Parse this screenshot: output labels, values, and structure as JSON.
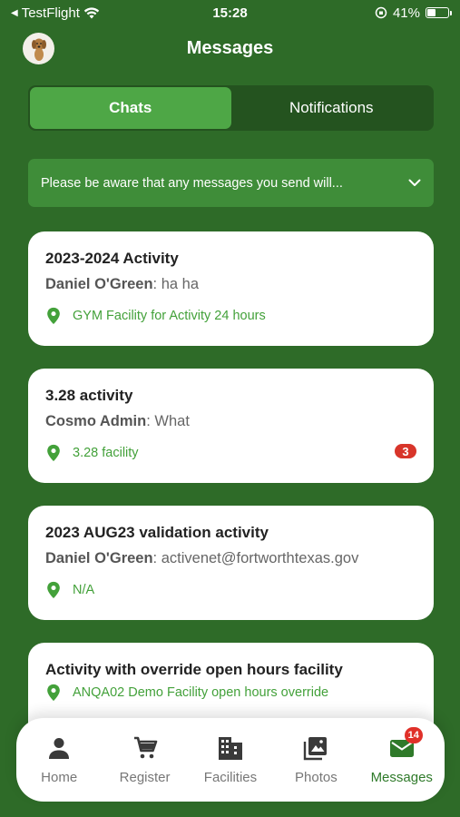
{
  "status_bar": {
    "back_app": "TestFlight",
    "time": "15:28",
    "battery": "41%",
    "battery_level": 0.41
  },
  "header": {
    "title": "Messages"
  },
  "tabs": [
    {
      "label": "Chats",
      "active": true
    },
    {
      "label": "Notifications",
      "active": false
    }
  ],
  "notice": {
    "text": "Please be aware that any messages you send will..."
  },
  "chats": [
    {
      "title": "2023-2024 Activity",
      "sender": "Daniel O'Green",
      "message": "ha ha",
      "location": "GYM Facility for Activity 24 hours",
      "unread": ""
    },
    {
      "title": "3.28 activity",
      "sender": "Cosmo Admin",
      "message": "What",
      "location": "3.28 facility",
      "unread": "3"
    },
    {
      "title": "2023 AUG23 validation activity",
      "sender": "Daniel O'Green",
      "message": "activenet@fortworthtexas.gov",
      "location": "N/A",
      "unread": ""
    },
    {
      "title": "Activity with override open hours facility",
      "sender": "",
      "message": "",
      "location": "ANQA02 Demo Facility open hours override",
      "unread": ""
    }
  ],
  "bottom_nav": [
    {
      "label": "Home",
      "icon": "person-icon",
      "active": false
    },
    {
      "label": "Register",
      "icon": "cart-icon",
      "active": false
    },
    {
      "label": "Facilities",
      "icon": "building-icon",
      "active": false
    },
    {
      "label": "Photos",
      "icon": "photos-icon",
      "active": false
    },
    {
      "label": "Messages",
      "icon": "mail-icon",
      "active": true,
      "badge": "14"
    }
  ],
  "colors": {
    "background": "#2e6b28",
    "accent": "#4ea746",
    "location_green": "#43a13a",
    "badge_red": "#d8352a"
  }
}
